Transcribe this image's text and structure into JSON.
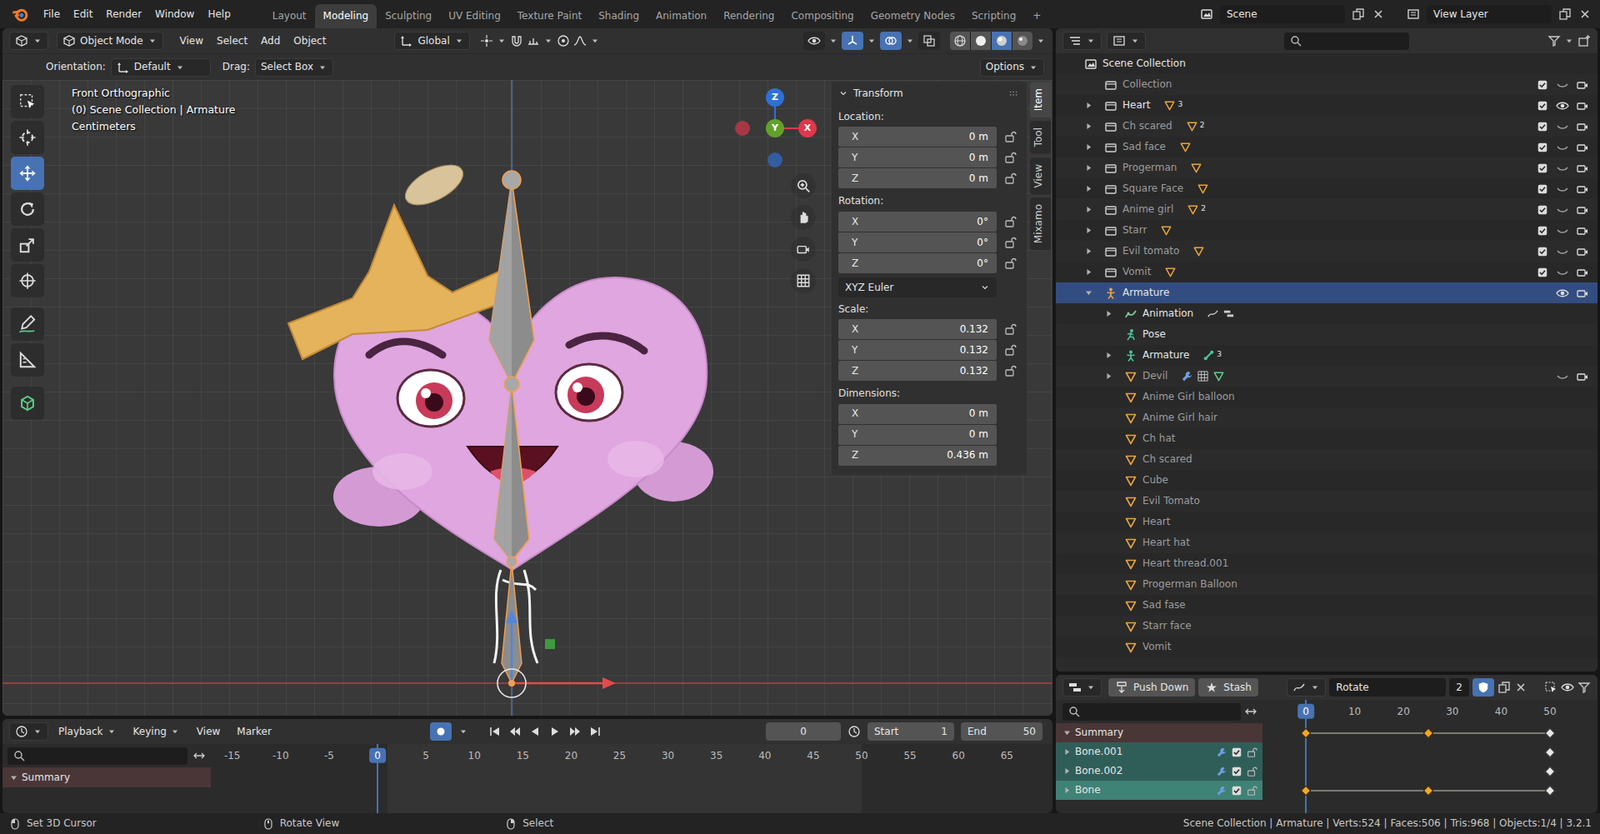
{
  "topbar": {
    "menus": [
      "File",
      "Edit",
      "Render",
      "Window",
      "Help"
    ],
    "workspaces": [
      {
        "label": "Layout",
        "selected": false
      },
      {
        "label": "Modeling",
        "selected": true
      },
      {
        "label": "Sculpting",
        "selected": false
      },
      {
        "label": "UV Editing",
        "selected": false
      },
      {
        "label": "Texture Paint",
        "selected": false
      },
      {
        "label": "Shading",
        "selected": false
      },
      {
        "label": "Animation",
        "selected": false
      },
      {
        "label": "Rendering",
        "selected": false
      },
      {
        "label": "Compositing",
        "selected": false
      },
      {
        "label": "Geometry Nodes",
        "selected": false
      },
      {
        "label": "Scripting",
        "selected": false
      }
    ],
    "add_workspace": "+",
    "scene": "Scene",
    "view_layer": "View Layer"
  },
  "viewport": {
    "mode": "Object Mode",
    "menus": [
      "View",
      "Select",
      "Add",
      "Object"
    ],
    "transform_orientation": "Global",
    "header_toggles": [
      {
        "kind": "visibility",
        "on": false
      },
      {
        "kind": "gizmo",
        "on": true
      },
      {
        "kind": "overlay",
        "on": true
      },
      {
        "kind": "xray",
        "on": false
      }
    ],
    "shading": [
      {
        "kind": "wireframe",
        "selected": false
      },
      {
        "kind": "solid",
        "selected": false
      },
      {
        "kind": "material",
        "selected": true
      },
      {
        "kind": "rendered",
        "selected": false
      }
    ],
    "tool_settings": {
      "orientation_label": "Orientation:",
      "orientation": "Default",
      "drag_label": "Drag:",
      "drag": "Select Box",
      "options": "Options"
    },
    "overlay_text": [
      "Front Orthographic",
      "(0) Scene Collection | Armature",
      "Centimeters"
    ],
    "tools": [
      {
        "kind": "select",
        "selected": false
      },
      {
        "kind": "cursor",
        "selected": false
      },
      {
        "kind": "move",
        "selected": true
      },
      {
        "kind": "rotate",
        "selected": false
      },
      {
        "kind": "scale",
        "selected": false
      },
      {
        "kind": "transform",
        "selected": false
      },
      {
        "kind": "annotate",
        "selected": false
      },
      {
        "kind": "measure",
        "selected": false
      },
      {
        "kind": "add",
        "selected": false
      }
    ],
    "gizmo_axes": [
      {
        "label": "Z",
        "color": "#2f6fd8"
      },
      {
        "label": "Y",
        "color": "#62a12c"
      },
      {
        "label": "X",
        "color": "#e0384c"
      }
    ],
    "n_panel": {
      "title": "Transform",
      "sections": [
        {
          "label": "Location:",
          "locks": true,
          "fields": [
            {
              "axis": "X",
              "value": "0 m"
            },
            {
              "axis": "Y",
              "value": "0 m"
            },
            {
              "axis": "Z",
              "value": "0 m"
            }
          ]
        },
        {
          "label": "Rotation:",
          "locks": true,
          "fields": [
            {
              "axis": "X",
              "value": "0°"
            },
            {
              "axis": "Y",
              "value": "0°"
            },
            {
              "axis": "Z",
              "value": "0°"
            }
          ],
          "mode": "XYZ Euler"
        },
        {
          "label": "Scale:",
          "locks": true,
          "fields": [
            {
              "axis": "X",
              "value": "0.132"
            },
            {
              "axis": "Y",
              "value": "0.132"
            },
            {
              "axis": "Z",
              "value": "0.132"
            }
          ]
        },
        {
          "label": "Dimensions:",
          "locks": false,
          "fields": [
            {
              "axis": "X",
              "value": "0 m"
            },
            {
              "axis": "Y",
              "value": "0 m"
            },
            {
              "axis": "Z",
              "value": "0.436 m"
            }
          ]
        }
      ]
    },
    "side_tabs": [
      {
        "label": "Item",
        "selected": true
      },
      {
        "label": "Tool",
        "selected": false
      },
      {
        "label": "View",
        "selected": false
      },
      {
        "label": "Mixamo",
        "selected": false
      }
    ]
  },
  "timeline": {
    "menus": [
      "Playback",
      "Keying",
      "View",
      "Marker"
    ],
    "autokey": true,
    "current_frame": "0",
    "start_label": "Start",
    "start": "1",
    "end_label": "End",
    "end": "50",
    "ticks": [
      "-15",
      "-10",
      "-5",
      "0",
      "5",
      "10",
      "15",
      "20",
      "25",
      "30",
      "35",
      "40",
      "45",
      "50",
      "55",
      "60",
      "65"
    ],
    "playhead": "0",
    "channels": [
      {
        "label": "Summary",
        "expanded": true
      }
    ]
  },
  "outliner": {
    "items": [
      {
        "label": "Scene Collection",
        "kind": "scene",
        "selected": false,
        "visible": true,
        "children": [
          {
            "label": "Collection",
            "kind": "collection",
            "selected": false,
            "visible": false,
            "checked": true,
            "eye": false
          },
          {
            "label": "Heart",
            "kind": "collection",
            "selected": false,
            "visible": true,
            "expanded": false,
            "child_kinds": [
              "mesh"
            ],
            "count": "3",
            "checked": true,
            "eye": true
          },
          {
            "label": "Ch scared",
            "kind": "collection",
            "selected": false,
            "visible": false,
            "expanded": false,
            "child_kinds": [
              "mesh"
            ],
            "count": "2",
            "checked": true,
            "eye": false
          },
          {
            "label": "Sad face",
            "kind": "collection",
            "selected": false,
            "visible": false,
            "expanded": false,
            "child_kinds": [
              "mesh"
            ],
            "checked": true,
            "eye": false
          },
          {
            "label": "Progerman",
            "kind": "collection",
            "selected": false,
            "visible": false,
            "expanded": false,
            "child_kinds": [
              "mesh"
            ],
            "checked": true,
            "eye": false
          },
          {
            "label": "Square Face",
            "kind": "collection",
            "selected": false,
            "visible": false,
            "expanded": false,
            "child_kinds": [
              "mesh"
            ],
            "checked": true,
            "eye": false
          },
          {
            "label": "Anime girl",
            "kind": "collection",
            "selected": false,
            "visible": false,
            "expanded": false,
            "child_kinds": [
              "mesh"
            ],
            "count": "2",
            "checked": true,
            "eye": false
          },
          {
            "label": "Starr",
            "kind": "collection",
            "selected": false,
            "visible": false,
            "expanded": false,
            "child_kinds": [
              "mesh"
            ],
            "checked": true,
            "eye": false
          },
          {
            "label": "Evil tomato",
            "kind": "collection",
            "selected": false,
            "visible": false,
            "expanded": false,
            "child_kinds": [
              "mesh"
            ],
            "checked": true,
            "eye": false
          },
          {
            "label": "Vomit",
            "kind": "collection",
            "selected": false,
            "visible": false,
            "expanded": false,
            "child_kinds": [
              "mesh"
            ],
            "checked": true,
            "eye": false
          },
          {
            "label": "Armature",
            "kind": "armature",
            "selected": true,
            "visible": true,
            "expanded": true,
            "eye": true,
            "children": [
              {
                "label": "Animation",
                "kind": "animation",
                "selected": false,
                "visible": true,
                "expanded": false,
                "child_kinds": [
                  "action",
                  "nla"
                ]
              },
              {
                "label": "Pose",
                "kind": "pose",
                "selected": false,
                "visible": true
              },
              {
                "label": "Armature",
                "kind": "armature_data",
                "selected": false,
                "visible": true,
                "expanded": false,
                "child_kinds": [
                  "bone"
                ],
                "count": "3"
              },
              {
                "label": "Devil",
                "kind": "mesh",
                "selected": false,
                "visible": false,
                "expanded": false,
                "child_kinds": [
                  "modifier",
                  "vgroup",
                  "mesh_data"
                ],
                "eye": false
              },
              {
                "label": "Anime Girl balloon",
                "kind": "mesh",
                "selected": false,
                "visible": false
              },
              {
                "label": "Anime Girl hair",
                "kind": "mesh",
                "selected": false,
                "visible": false
              },
              {
                "label": "Ch hat",
                "kind": "mesh",
                "selected": false,
                "visible": false
              },
              {
                "label": "Ch scared",
                "kind": "mesh",
                "selected": false,
                "visible": false
              },
              {
                "label": "Cube",
                "kind": "mesh",
                "selected": false,
                "visible": false
              },
              {
                "label": "Evil Tomato",
                "kind": "mesh",
                "selected": false,
                "visible": false
              },
              {
                "label": "Heart",
                "kind": "mesh",
                "selected": false,
                "visible": false
              },
              {
                "label": "Heart hat",
                "kind": "mesh",
                "selected": false,
                "visible": false
              },
              {
                "label": "Heart thread.001",
                "kind": "mesh",
                "selected": false,
                "visible": false
              },
              {
                "label": "Progerman Balloon",
                "kind": "mesh",
                "selected": false,
                "visible": false
              },
              {
                "label": "Sad fase",
                "kind": "mesh",
                "selected": false,
                "visible": false
              },
              {
                "label": "Starr face",
                "kind": "mesh",
                "selected": false,
                "visible": false
              },
              {
                "label": "Vomit",
                "kind": "mesh",
                "selected": false,
                "visible": false
              }
            ]
          }
        ]
      }
    ]
  },
  "nla": {
    "push_down": "Push Down",
    "stash": "Stash",
    "action": "Rotate",
    "users": "2",
    "fake_user": true,
    "ticks": [
      "0",
      "10",
      "20",
      "30",
      "40",
      "50"
    ],
    "playhead": "0",
    "channels": [
      {
        "label": "Summary",
        "kind": "sum",
        "selected": false,
        "expanded": true,
        "hold": true,
        "keys": [
          {
            "frame": 0,
            "selected": true
          },
          {
            "frame": 25,
            "selected": true
          },
          {
            "frame": 50,
            "selected": false
          }
        ]
      },
      {
        "label": "Bone.001",
        "kind": "bone",
        "selected": false,
        "expanded": false,
        "enabled": true,
        "hold": false,
        "keys": [
          {
            "frame": 50,
            "selected": false
          }
        ]
      },
      {
        "label": "Bone.002",
        "kind": "bone",
        "selected": false,
        "expanded": false,
        "enabled": true,
        "hold": false,
        "keys": [
          {
            "frame": 50,
            "selected": false
          }
        ]
      },
      {
        "label": "Bone",
        "kind": "bone",
        "selected": true,
        "expanded": false,
        "enabled": true,
        "hold": true,
        "keys": [
          {
            "frame": 0,
            "selected": true
          },
          {
            "frame": 25,
            "selected": true
          },
          {
            "frame": 50,
            "selected": false
          }
        ]
      }
    ]
  },
  "status_bar": {
    "hints": [
      {
        "label": "Set 3D Cursor",
        "kind": "mouse_left"
      },
      {
        "label": "Rotate View",
        "kind": "mouse_mid"
      },
      {
        "label": "Select",
        "kind": "mouse_right"
      }
    ],
    "stats": "Scene Collection | Armature | Verts:524 | Faces:506 | Tris:968 | Objects:1/4 | 3.2.1"
  }
}
